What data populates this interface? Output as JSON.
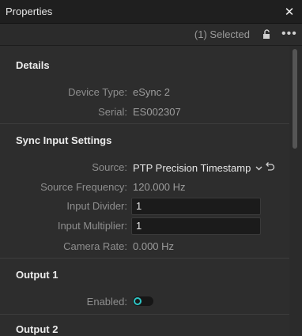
{
  "window": {
    "title": "Properties"
  },
  "toolbar": {
    "selection_text": "(1) Selected"
  },
  "sections": {
    "details": {
      "title": "Details",
      "device_type_label": "Device Type:",
      "device_type_value": "eSync 2",
      "serial_label": "Serial:",
      "serial_value": "ES002307"
    },
    "sync_input": {
      "title": "Sync Input Settings",
      "source_label": "Source:",
      "source_value": "PTP Precision Timestamp",
      "source_frequency_label": "Source Frequency:",
      "source_frequency_value": "120.000 Hz",
      "input_divider_label": "Input Divider:",
      "input_divider_value": "1",
      "input_multiplier_label": "Input Multiplier:",
      "input_multiplier_value": "1",
      "camera_rate_label": "Camera Rate:",
      "camera_rate_value": "0.000 Hz"
    },
    "output1": {
      "title": "Output 1",
      "enabled_label": "Enabled:",
      "enabled": false
    },
    "output2": {
      "title": "Output 2"
    }
  },
  "colors": {
    "accent": "#2ec4c4",
    "background": "#2d2d2d",
    "titlebar": "#1f1f1f"
  },
  "icons": {
    "close": "close-icon",
    "lock": "lock-icon",
    "more": "more-options-icon",
    "dropdown": "chevron-down-icon",
    "reset": "undo-icon"
  }
}
